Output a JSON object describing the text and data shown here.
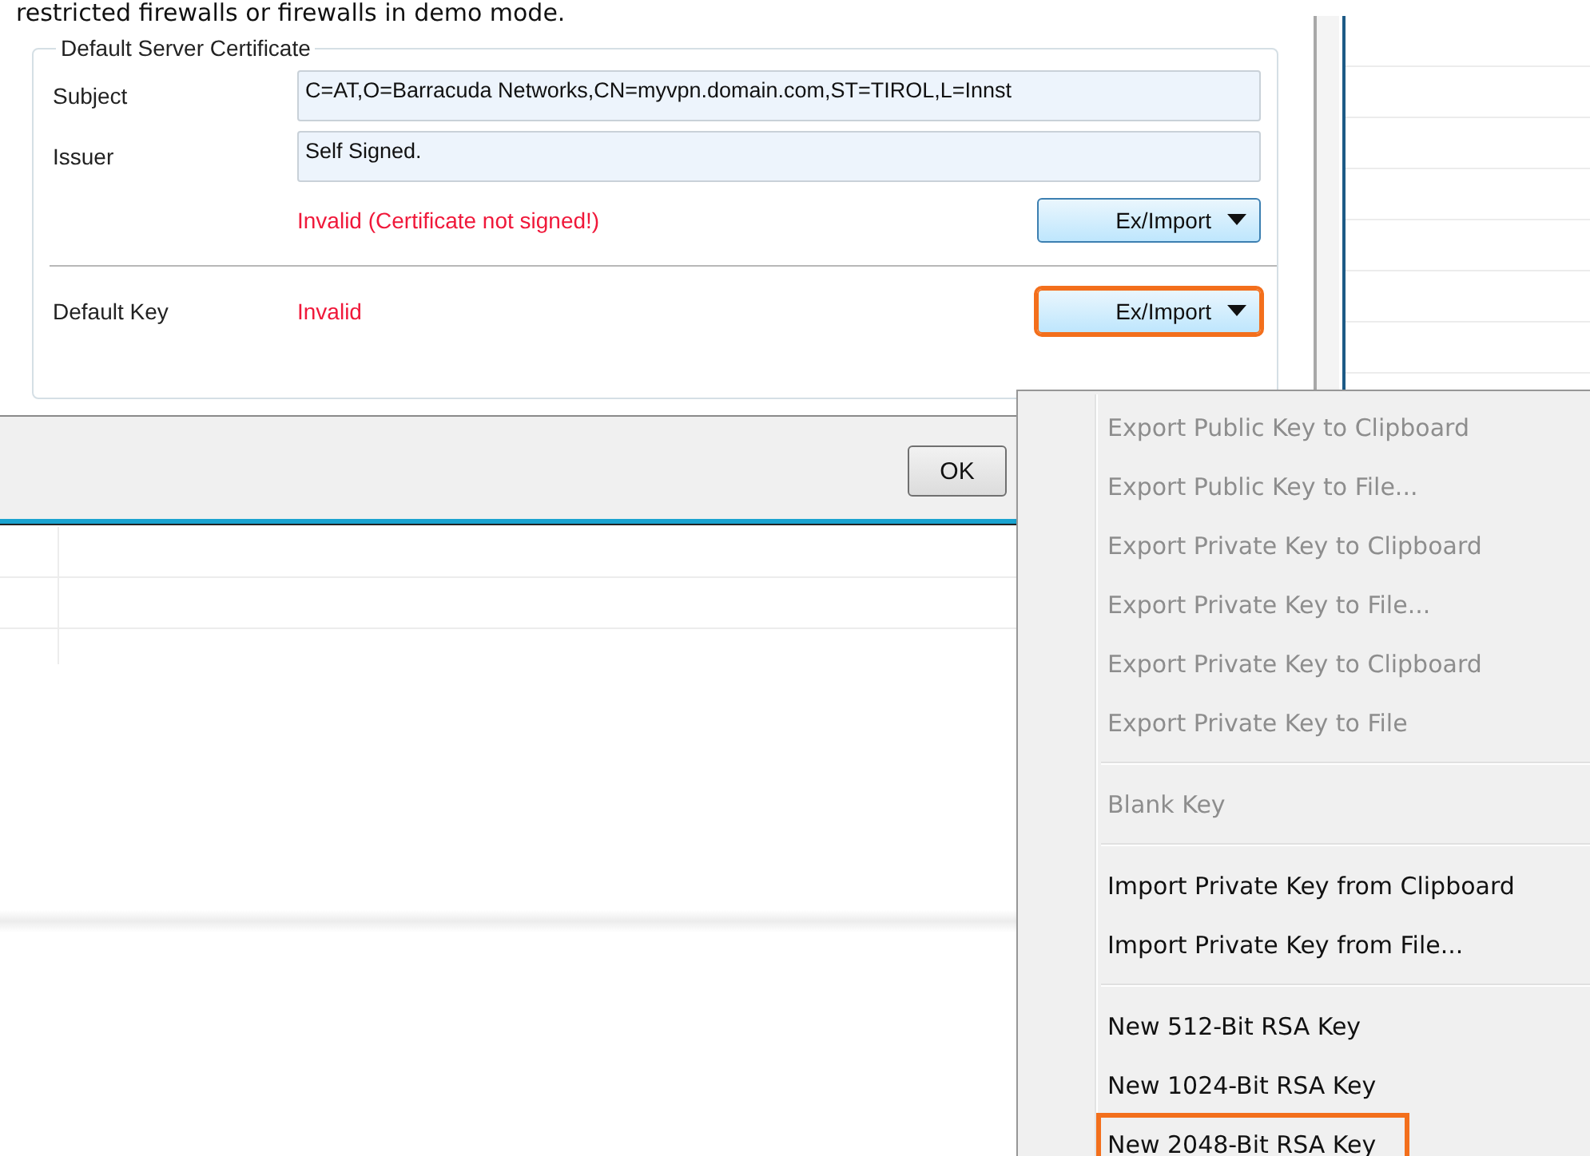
{
  "intro_text": "restricted firewalls or firewalls in demo mode.",
  "certificate_group": {
    "title": "Default Server Certificate",
    "fields": [
      {
        "label": "Subject",
        "value": "C=AT,O=Barracuda Networks,CN=myvpn.domain.com,ST=TIROL,L=Innst"
      },
      {
        "label": "Issuer",
        "value": "Self Signed."
      }
    ],
    "status": "Invalid (Certificate not signed!)",
    "button": {
      "label": "Ex/Import",
      "highlighted": false
    },
    "key": {
      "label": "Default Key",
      "status": "Invalid",
      "button": {
        "label": "Ex/Import",
        "highlighted": true
      }
    }
  },
  "dialog_buttons": [
    {
      "label": "OK"
    }
  ],
  "menu": {
    "items": [
      {
        "kind": "item",
        "label": "Export Public Key to Clipboard",
        "disabled": true,
        "highlighted": false
      },
      {
        "kind": "item",
        "label": "Export Public Key to File...",
        "disabled": true,
        "highlighted": false
      },
      {
        "kind": "item",
        "label": "Export Private Key to Clipboard",
        "disabled": true,
        "highlighted": false
      },
      {
        "kind": "item",
        "label": "Export Private Key to File...",
        "disabled": true,
        "highlighted": false
      },
      {
        "kind": "item",
        "label": "Export Private Key to Clipboard",
        "disabled": true,
        "highlighted": false
      },
      {
        "kind": "item",
        "label": "Export Private Key to File",
        "disabled": true,
        "highlighted": false
      },
      {
        "kind": "separator"
      },
      {
        "kind": "item",
        "label": "Blank Key",
        "disabled": true,
        "highlighted": false
      },
      {
        "kind": "separator"
      },
      {
        "kind": "item",
        "label": "Import Private Key from Clipboard",
        "disabled": false,
        "highlighted": false
      },
      {
        "kind": "item",
        "label": "Import Private Key from File...",
        "disabled": false,
        "highlighted": false
      },
      {
        "kind": "separator"
      },
      {
        "kind": "item",
        "label": "New 512-Bit RSA Key",
        "disabled": false,
        "highlighted": false
      },
      {
        "kind": "item",
        "label": "New 1024-Bit RSA Key",
        "disabled": false,
        "highlighted": false
      },
      {
        "kind": "item",
        "label": "New 2048-Bit RSA Key",
        "disabled": false,
        "highlighted": true
      }
    ]
  }
}
